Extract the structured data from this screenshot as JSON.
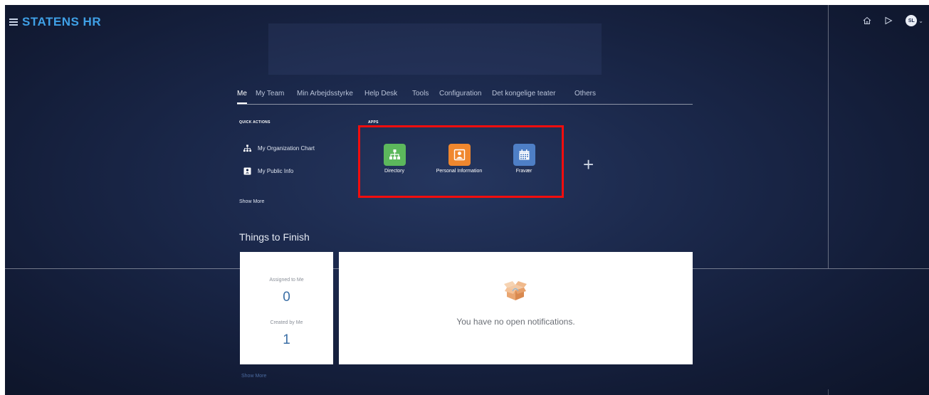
{
  "header": {
    "brand": "STATENS HR",
    "avatar_initials": "SL",
    "icons": [
      "home-icon",
      "navigator-icon",
      "avatar",
      "chevron-down-icon"
    ]
  },
  "tabs": [
    {
      "label": "Me",
      "active": true
    },
    {
      "label": "My Team",
      "active": false
    },
    {
      "label": "Min Arbejdsstyrke",
      "active": false
    },
    {
      "label": "Help Desk",
      "active": false
    },
    {
      "label": "Tools",
      "active": false
    },
    {
      "label": "Configuration",
      "active": false
    },
    {
      "label": "Det kongelige teater",
      "active": false
    },
    {
      "label": "Others",
      "active": false
    }
  ],
  "quick_actions": {
    "title": "QUICK ACTIONS",
    "items": [
      {
        "label": "My Organization Chart",
        "icon": "org-chart-icon"
      },
      {
        "label": "My Public Info",
        "icon": "id-card-icon"
      }
    ],
    "show_more": "Show More"
  },
  "apps": {
    "title": "APPS",
    "items": [
      {
        "label": "Directory",
        "icon": "directory-icon",
        "color": "#5cb85c"
      },
      {
        "label": "Personal Information",
        "icon": "person-icon",
        "color": "#f0872e"
      },
      {
        "label": "Fravær",
        "icon": "calendar-icon",
        "color": "#4e7fc6"
      }
    ],
    "add_icon": "plus-icon",
    "highlight_color": "#f20d0d"
  },
  "things_to_finish": {
    "title": "Things to Finish",
    "assigned_label": "Assigned to Me",
    "assigned_count": "0",
    "created_label": "Created by Me",
    "created_count": "1",
    "empty_message": "You have no open notifications.",
    "show_more": "Show More"
  }
}
